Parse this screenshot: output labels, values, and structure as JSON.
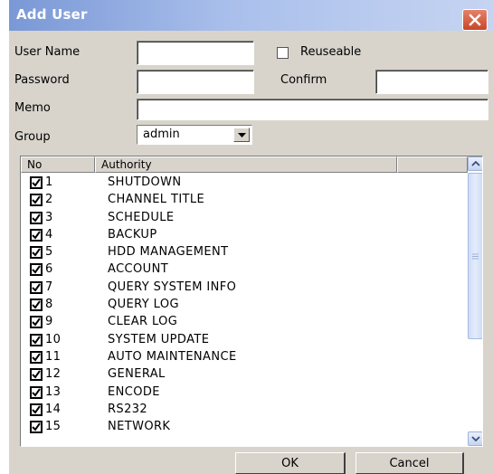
{
  "window": {
    "title": "Add User"
  },
  "form": {
    "user_name_label": "User Name",
    "user_name_value": "",
    "reuseable_label": "Reuseable",
    "reuseable_checked": false,
    "password_label": "Password",
    "password_value": "",
    "confirm_label": "Confirm",
    "confirm_value": "",
    "memo_label": "Memo",
    "memo_value": "",
    "group_label": "Group",
    "group_value": "admin"
  },
  "authority_list": {
    "columns": [
      "No",
      "Authority"
    ],
    "rows": [
      {
        "no": "1",
        "authority": "SHUTDOWN",
        "checked": true
      },
      {
        "no": "2",
        "authority": "CHANNEL TITLE",
        "checked": true
      },
      {
        "no": "3",
        "authority": "SCHEDULE",
        "checked": true
      },
      {
        "no": "4",
        "authority": "BACKUP",
        "checked": true
      },
      {
        "no": "5",
        "authority": "HDD MANAGEMENT",
        "checked": true
      },
      {
        "no": "6",
        "authority": "ACCOUNT",
        "checked": true
      },
      {
        "no": "7",
        "authority": "QUERY SYSTEM INFO",
        "checked": true
      },
      {
        "no": "8",
        "authority": "QUERY LOG",
        "checked": true
      },
      {
        "no": "9",
        "authority": "CLEAR LOG",
        "checked": true
      },
      {
        "no": "10",
        "authority": "SYSTEM UPDATE",
        "checked": true
      },
      {
        "no": "11",
        "authority": "AUTO MAINTENANCE",
        "checked": true
      },
      {
        "no": "12",
        "authority": "GENERAL",
        "checked": true
      },
      {
        "no": "13",
        "authority": "ENCODE",
        "checked": true
      },
      {
        "no": "14",
        "authority": "RS232",
        "checked": true
      },
      {
        "no": "15",
        "authority": "NETWORK",
        "checked": true
      }
    ]
  },
  "buttons": {
    "ok": "OK",
    "cancel": "Cancel"
  },
  "colors": {
    "dialog_bg": "#d8d4cc",
    "title_gradient_start": "#7a98d6",
    "close_button": "#c74627"
  }
}
